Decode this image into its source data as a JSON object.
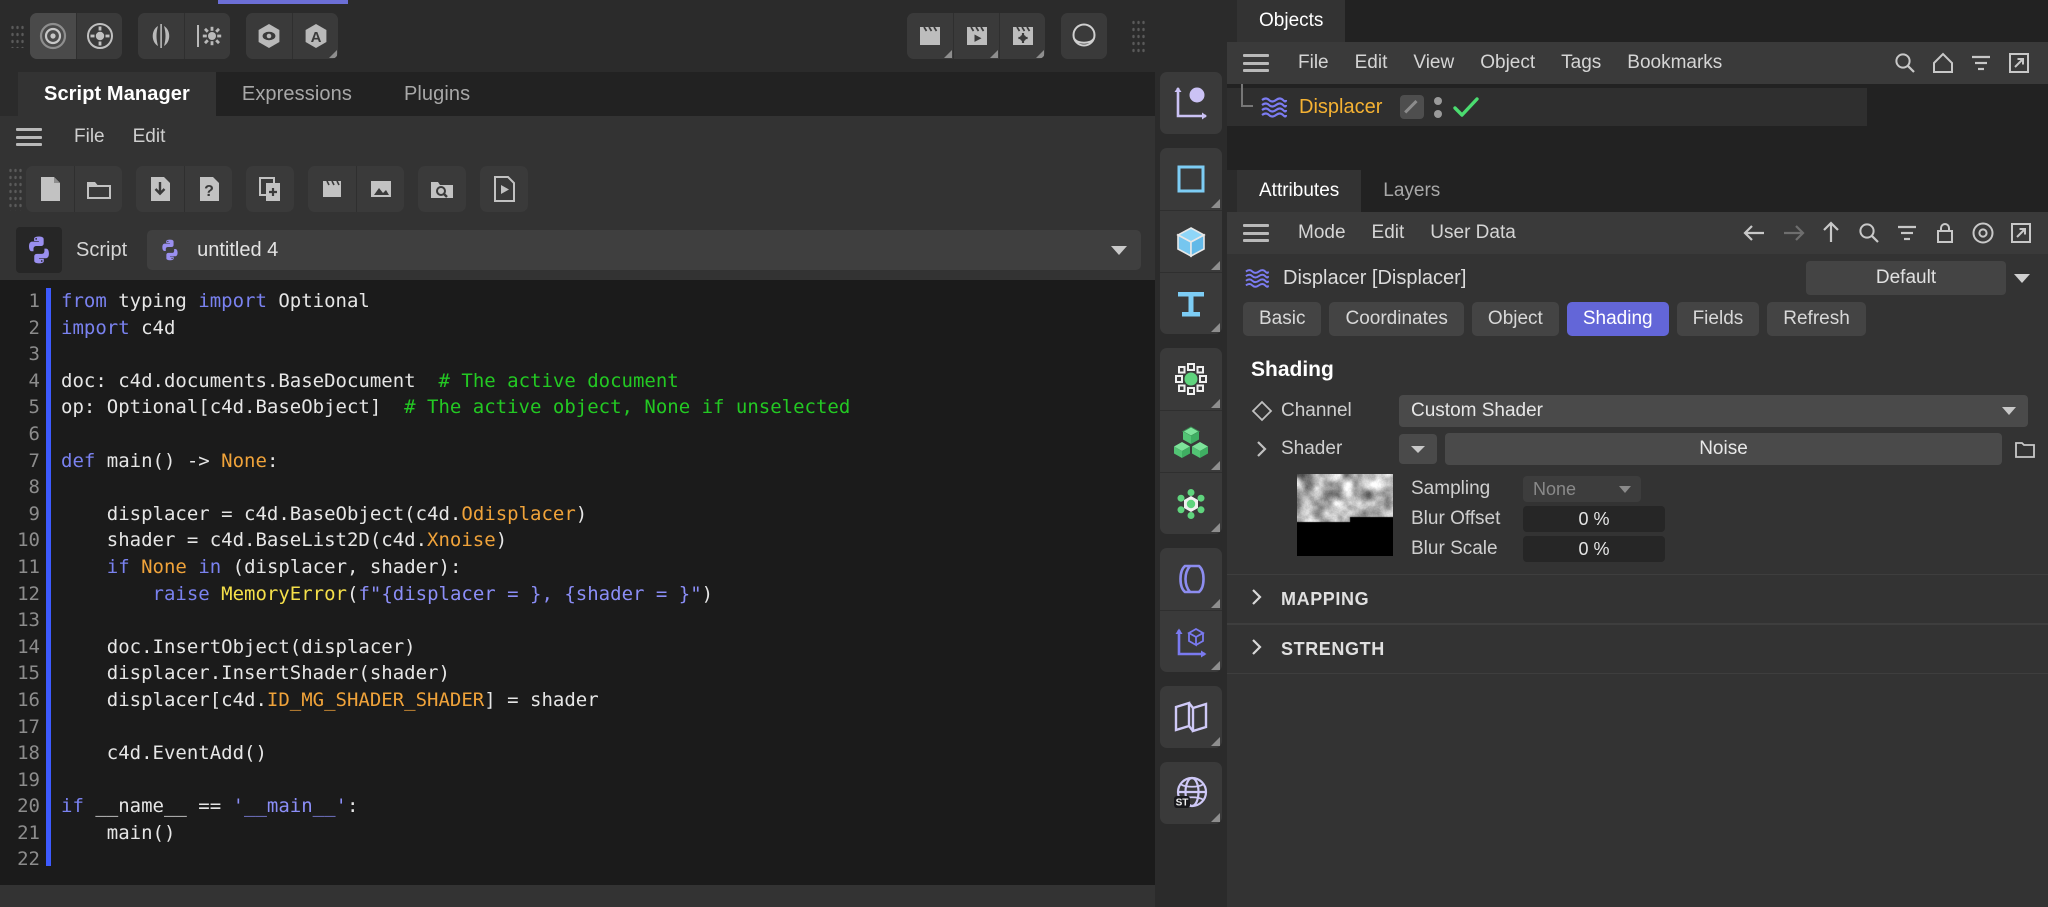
{
  "left_panel": {
    "top_toolbar": {
      "groups": [
        {
          "buttons": [
            {
              "icon": "concentric-circles-icon",
              "selected": true
            },
            {
              "icon": "gear-circle-icon",
              "selected": false
            }
          ]
        },
        {
          "buttons": [
            {
              "icon": "mirror-icon",
              "selected": false
            },
            {
              "icon": "axis-gear-icon",
              "selected": false
            }
          ]
        },
        {
          "buttons": [
            {
              "icon": "eye-hex-icon",
              "selected": false
            },
            {
              "icon": "letter-a-hex-icon",
              "selected": false
            }
          ]
        }
      ],
      "right_groups": [
        {
          "buttons": [
            {
              "icon": "clapperboard-icon"
            },
            {
              "icon": "clapperboard-play-icon"
            },
            {
              "icon": "clapperboard-gear-icon"
            }
          ]
        },
        {
          "buttons": [
            {
              "icon": "sphere-render-icon"
            }
          ]
        }
      ]
    },
    "tabs": [
      {
        "label": "Script Manager",
        "active": true
      },
      {
        "label": "Expressions",
        "active": false
      },
      {
        "label": "Plugins",
        "active": false
      }
    ],
    "menu": [
      "File",
      "Edit"
    ],
    "script_toolbar": [
      {
        "icon": "new-file-icon"
      },
      {
        "icon": "open-folder-icon"
      },
      {
        "icon": "save-download-icon"
      },
      {
        "icon": "help-question-icon"
      },
      {
        "icon": "duplicate-add-icon"
      },
      {
        "icon": "clapperboard-icon"
      },
      {
        "icon": "image-icon"
      },
      {
        "icon": "search-folder-icon"
      },
      {
        "icon": "execute-play-icon"
      }
    ],
    "script_selector": {
      "python_icon": "python-logo-icon",
      "label": "Script",
      "current_script": "untitled 4"
    },
    "editor": {
      "first_line": 1,
      "last_line": 22,
      "lines": [
        {
          "n": 1,
          "text": "from typing import Optional"
        },
        {
          "n": 2,
          "text": "import c4d"
        },
        {
          "n": 3,
          "text": ""
        },
        {
          "n": 4,
          "text": "doc: c4d.documents.BaseDocument  # The active document"
        },
        {
          "n": 5,
          "text": "op: Optional[c4d.BaseObject]  # The active object, None if unselected"
        },
        {
          "n": 6,
          "text": ""
        },
        {
          "n": 7,
          "text": "def main() -> None:"
        },
        {
          "n": 8,
          "text": ""
        },
        {
          "n": 9,
          "text": "    displacer = c4d.BaseObject(c4d.Odisplacer)"
        },
        {
          "n": 10,
          "text": "    shader = c4d.BaseList2D(c4d.Xnoise)"
        },
        {
          "n": 11,
          "text": "    if None in (displacer, shader):"
        },
        {
          "n": 12,
          "text": "        raise MemoryError(f\"{displacer = }, {shader = }\")"
        },
        {
          "n": 13,
          "text": ""
        },
        {
          "n": 14,
          "text": "    doc.InsertObject(displacer)"
        },
        {
          "n": 15,
          "text": "    displacer.InsertShader(shader)"
        },
        {
          "n": 16,
          "text": "    displacer[c4d.ID_MG_SHADER_SHADER] = shader"
        },
        {
          "n": 17,
          "text": ""
        },
        {
          "n": 18,
          "text": "    c4d.EventAdd()"
        },
        {
          "n": 19,
          "text": ""
        },
        {
          "n": 20,
          "text": "if __name__ == '__main__':"
        },
        {
          "n": 21,
          "text": "    main()"
        },
        {
          "n": 22,
          "text": ""
        }
      ]
    }
  },
  "rail": {
    "groups": [
      {
        "buttons": [
          {
            "icon": "axis-sphere-icon",
            "color": "#cbc2f5"
          }
        ]
      },
      {
        "buttons": [
          {
            "icon": "square-spline-icon",
            "color": "#7dcdf5"
          },
          {
            "icon": "cube-primitive-icon",
            "color": "#7dcdf5"
          },
          {
            "icon": "text-tool-icon",
            "color": "#7dcdf5"
          }
        ]
      },
      {
        "buttons": [
          {
            "icon": "nurbs-generator-icon",
            "color": "#5fd47d"
          },
          {
            "icon": "array-clone-icon",
            "color": "#5fd47d"
          },
          {
            "icon": "mograph-gear-icon",
            "color": "#5fd47d"
          }
        ]
      },
      {
        "buttons": [
          {
            "icon": "deformer-bend-icon",
            "color": "#8d8df0"
          },
          {
            "icon": "axis-cube-icon",
            "color": "#8d8df0"
          }
        ]
      },
      {
        "buttons": [
          {
            "icon": "symmetry-icon",
            "color": "#cfc9f7"
          }
        ]
      },
      {
        "buttons": [
          {
            "icon": "scene-nodes-globe-icon",
            "color": "#cfc9f7",
            "badge": "ST"
          }
        ]
      }
    ]
  },
  "right_panel": {
    "objects": {
      "tab_label": "Objects",
      "menu": [
        "File",
        "Edit",
        "View",
        "Object",
        "Tags",
        "Bookmarks"
      ],
      "icons": [
        "search-icon",
        "home-icon",
        "filter-icon",
        "popout-icon"
      ],
      "tree": [
        {
          "name": "Displacer",
          "object_icon": "displacer-waves-icon",
          "tag_icon": "displacer-tag-icon",
          "visibility_dots": "visibility-dots-icon",
          "check_icon": "green-check-icon",
          "selected": true
        }
      ]
    },
    "attributes": {
      "tabs": [
        {
          "label": "Attributes",
          "active": true
        },
        {
          "label": "Layers",
          "active": false
        }
      ],
      "menu": [
        "Mode",
        "Edit",
        "User Data"
      ],
      "nav_icons": [
        "back-arrow-icon",
        "forward-arrow-icon",
        "up-arrow-icon",
        "search-icon",
        "filter-icon",
        "lock-icon",
        "target-icon",
        "popout-icon"
      ],
      "object_title": "Displacer [Displacer]",
      "object_icon": "displacer-waves-icon",
      "preset": "Default",
      "param_tabs": [
        {
          "label": "Basic",
          "active": false
        },
        {
          "label": "Coordinates",
          "active": false
        },
        {
          "label": "Object",
          "active": false
        },
        {
          "label": "Shading",
          "active": true
        },
        {
          "label": "Fields",
          "active": false
        },
        {
          "label": "Refresh",
          "active": false
        }
      ],
      "shading": {
        "section_title": "Shading",
        "channel": {
          "label": "Channel",
          "value": "Custom Shader",
          "icon": "diamond-keyframe-icon"
        },
        "shader": {
          "label": "Shader",
          "value": "Noise",
          "icon": "chevron-right-icon",
          "folder_icon": "folder-icon"
        },
        "thumbnail": "noise-shader-preview",
        "sampling": {
          "label": "Sampling",
          "value": "None"
        },
        "blur_offset": {
          "label": "Blur Offset",
          "value": "0 %"
        },
        "blur_scale": {
          "label": "Blur Scale",
          "value": "0 %"
        }
      },
      "collapsed_sections": [
        {
          "label": "MAPPING",
          "icon": "chevron-right-icon"
        },
        {
          "label": "STRENGTH",
          "icon": "chevron-right-icon"
        }
      ]
    }
  },
  "colors": {
    "accent_purple": "#6366d8",
    "selection_blue": "#3d5afe",
    "object_orange": "#f5b233",
    "comment_green": "#23c923",
    "keyword_purple": "#7a82f0",
    "class_orange": "#f0a33a",
    "error_yellow": "#f5e04a",
    "panel_bg": "#333333",
    "editor_bg": "#1b1b1b"
  }
}
